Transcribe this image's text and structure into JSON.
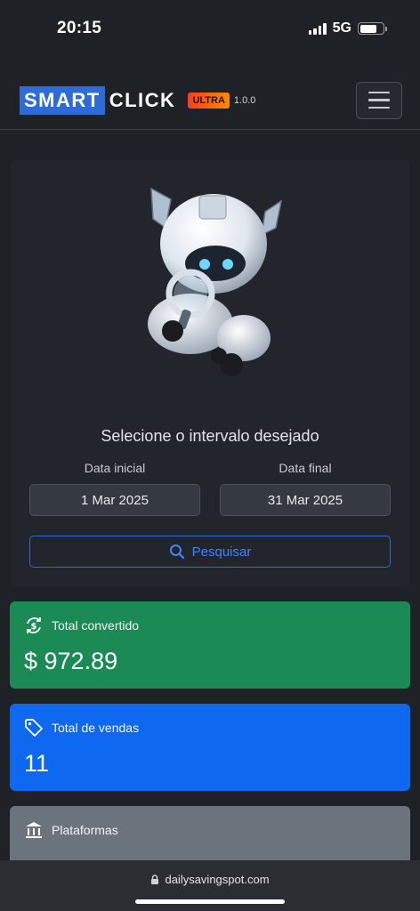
{
  "status_bar": {
    "time": "20:15",
    "network": "5G"
  },
  "header": {
    "logo_part1": "SMART",
    "logo_part2": "CLICK",
    "badge": "ULTRA",
    "version": "1.0.0"
  },
  "search": {
    "title": "Selecione o intervalo desejado",
    "start_label": "Data inicial",
    "end_label": "Data final",
    "start_value": "1 Mar 2025",
    "end_value": "31 Mar 2025",
    "button_label": "Pesquisar"
  },
  "stats": [
    {
      "label": "Total convertido",
      "value": "$ 972.89",
      "icon": "dollar-exchange-icon",
      "color": "#1b8a55"
    },
    {
      "label": "Total de vendas",
      "value": "11",
      "icon": "tag-icon",
      "color": "#0f68f0"
    },
    {
      "label": "Plataformas",
      "value": "",
      "icon": "bank-icon",
      "color": "#6b737c"
    }
  ],
  "browser": {
    "url": "dailysavingspot.com"
  },
  "colors": {
    "accent": "#2f6bd6",
    "background": "#1e2126"
  }
}
